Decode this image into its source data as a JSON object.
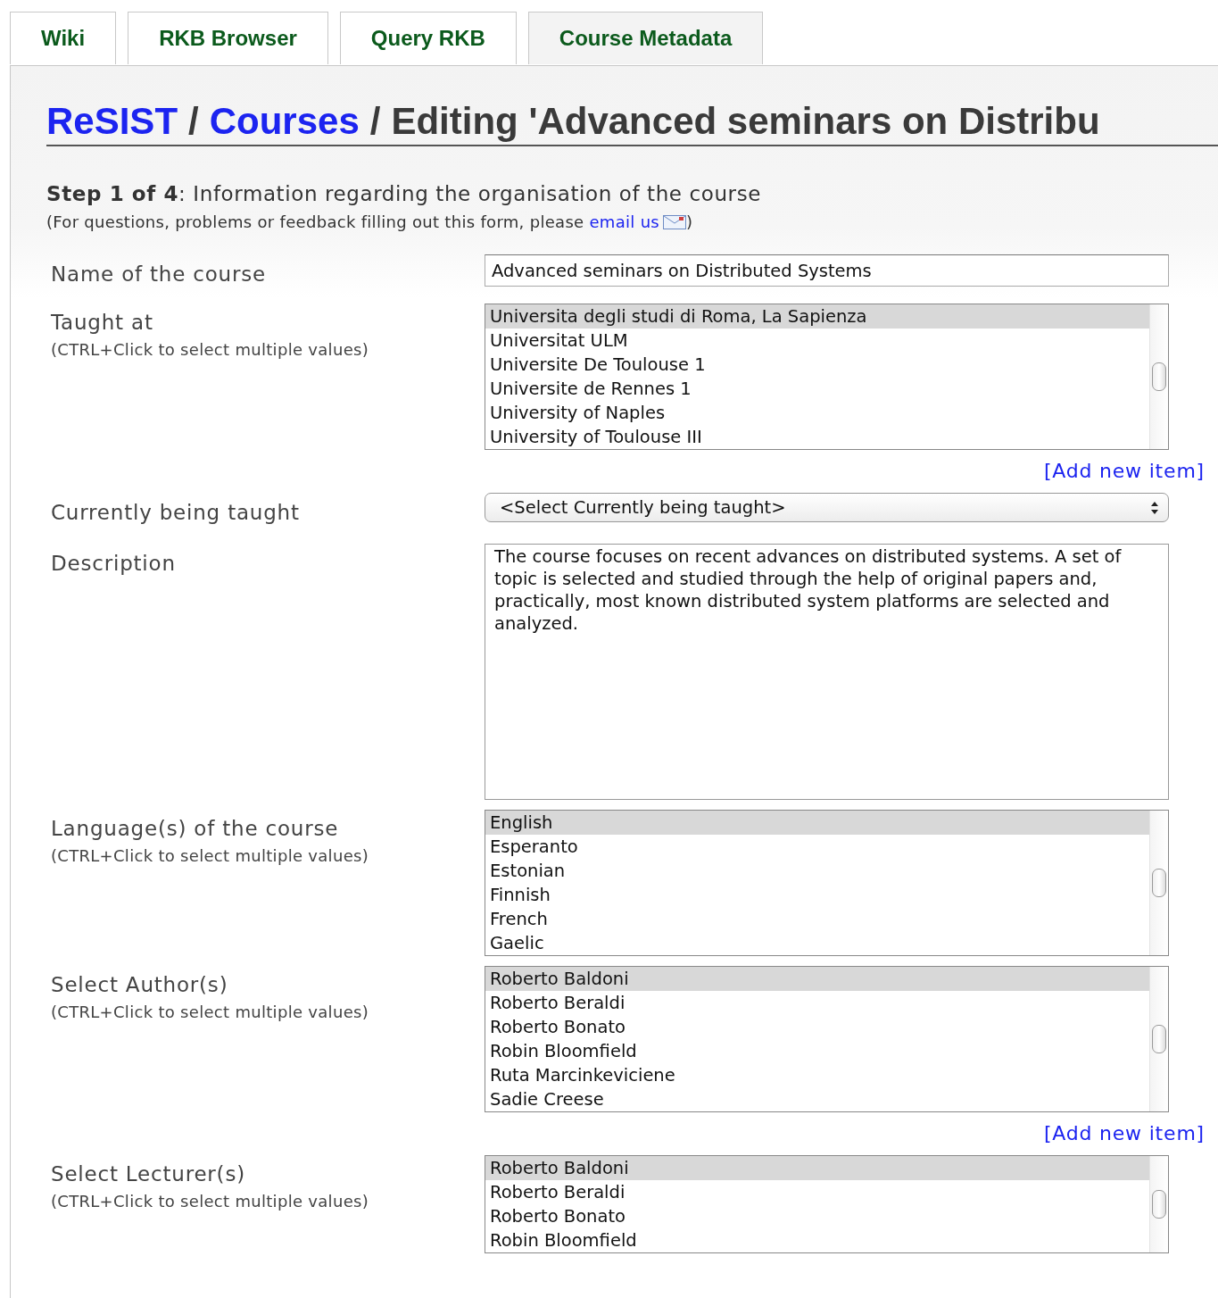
{
  "tabs": [
    {
      "label": "Wiki",
      "selected": false
    },
    {
      "label": "RKB Browser",
      "selected": false
    },
    {
      "label": "Query RKB",
      "selected": false
    },
    {
      "label": "Course Metadata",
      "selected": true
    }
  ],
  "breadcrumb": [
    {
      "kind": "link",
      "text": "ReSIST"
    },
    {
      "kind": "separator",
      "text": "/"
    },
    {
      "kind": "link",
      "text": "Courses"
    },
    {
      "kind": "separator",
      "text": "/"
    },
    {
      "kind": "current",
      "text": "Editing 'Advanced seminars on Distribu"
    }
  ],
  "step": "**Step 1 of 4**: Information regarding the organisation of the course",
  "help": {
    "before": "(For questions, problems or feedback filling out this form, please",
    "link": "email us",
    "after": ")"
  },
  "fields": [
    {
      "kind": "text",
      "label": "Name of the course",
      "value": "Advanced seminars on Distributed Systems"
    },
    {
      "kind": "listbox",
      "label": "Taught at",
      "hint": "(CTRL+Click to select multiple values)",
      "options": [
        {
          "text": "Universita degli studi di Roma, La Sapienza",
          "selected": true
        },
        {
          "text": "Universitat ULM",
          "selected": false
        },
        {
          "text": "Universite De Toulouse 1",
          "selected": false
        },
        {
          "text": "Universite de Rennes 1",
          "selected": false
        },
        {
          "text": "University of Naples",
          "selected": false
        },
        {
          "text": "University of Toulouse III",
          "selected": false
        }
      ],
      "add_link": "[Add new item]"
    },
    {
      "kind": "select",
      "label": "Currently being taught",
      "value": "<Select Currently being taught>"
    },
    {
      "kind": "textarea",
      "label": "Description",
      "value": "The course focuses on recent advances on distributed systems. A set of topic is selected and studied through the help of original papers and, practically, most known distributed system platforms are selected and analyzed."
    },
    {
      "kind": "listbox",
      "label": "Language(s) of the course",
      "hint": "(CTRL+Click to select multiple values)",
      "options": [
        {
          "text": "English",
          "selected": true
        },
        {
          "text": "Esperanto",
          "selected": false
        },
        {
          "text": "Estonian",
          "selected": false
        },
        {
          "text": "Finnish",
          "selected": false
        },
        {
          "text": "French",
          "selected": false
        },
        {
          "text": "Gaelic",
          "selected": false
        }
      ]
    },
    {
      "kind": "listbox",
      "label": "Select Author(s)",
      "hint": "(CTRL+Click to select multiple values)",
      "options": [
        {
          "text": "Roberto Baldoni",
          "selected": true
        },
        {
          "text": "Roberto Beraldi",
          "selected": false
        },
        {
          "text": "Roberto Bonato",
          "selected": false
        },
        {
          "text": "Robin Bloomfield",
          "selected": false
        },
        {
          "text": "Ruta Marcinkeviciene",
          "selected": false
        },
        {
          "text": "Sadie Creese",
          "selected": false
        }
      ],
      "add_link": "[Add new item]"
    },
    {
      "kind": "listbox",
      "label": "Select Lecturer(s)",
      "hint": "(CTRL+Click to select multiple values)",
      "options": [
        {
          "text": "Roberto Baldoni",
          "selected": true
        },
        {
          "text": "Roberto Beraldi",
          "selected": false
        },
        {
          "text": "Roberto Bonato",
          "selected": false
        },
        {
          "text": "Robin Bloomfield",
          "selected": false
        }
      ]
    }
  ]
}
